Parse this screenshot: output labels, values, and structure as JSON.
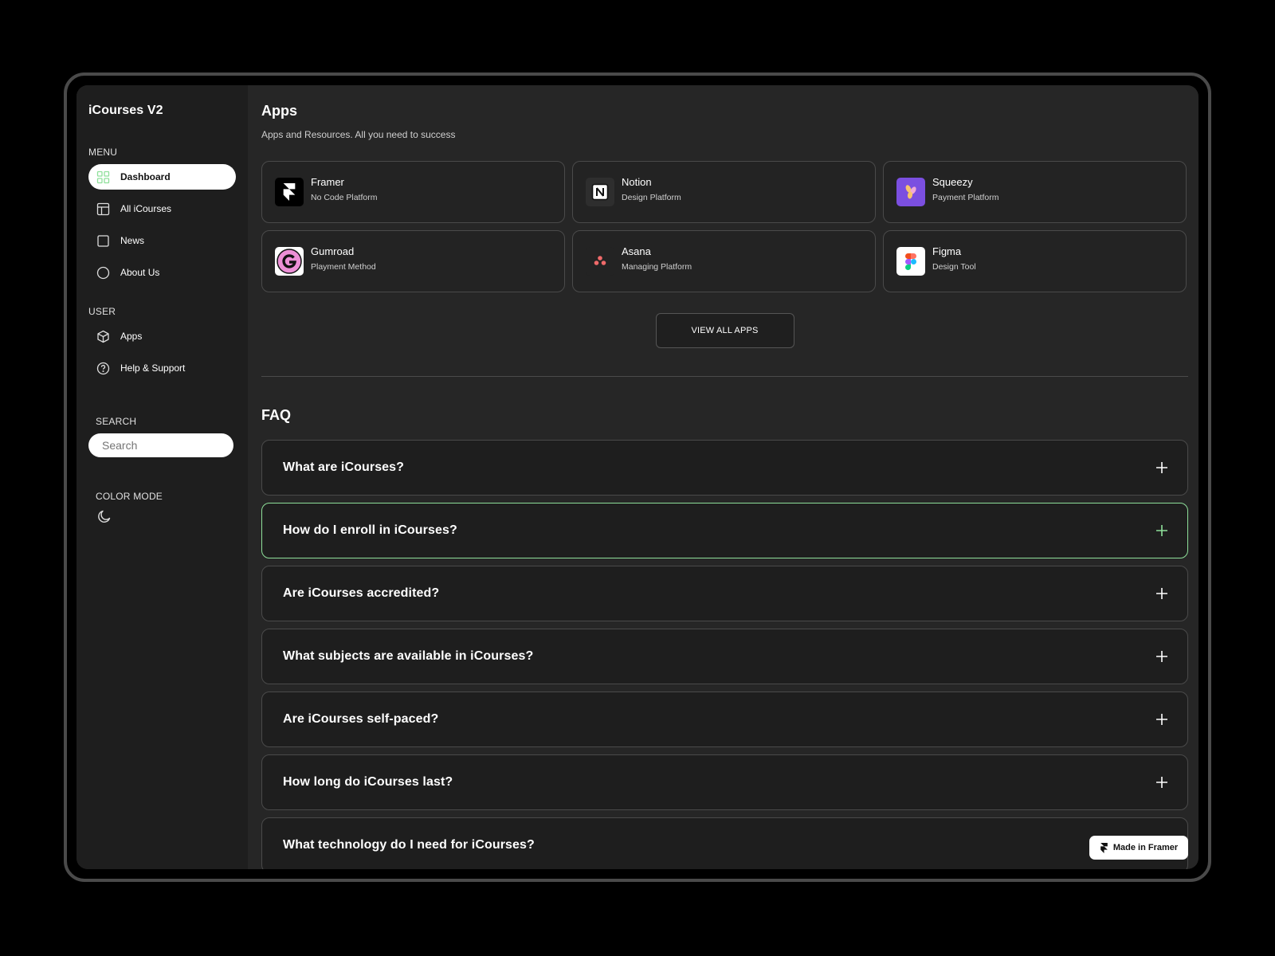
{
  "sidebar": {
    "brand": "iCourses V2",
    "menu_label": "MENU",
    "menu_items": [
      {
        "label": "Dashboard",
        "icon": "grid-icon",
        "active": true
      },
      {
        "label": "All iCourses",
        "icon": "layout-icon"
      },
      {
        "label": "News",
        "icon": "square-icon"
      },
      {
        "label": "About Us",
        "icon": "circle-icon"
      }
    ],
    "user_label": "USER",
    "user_items": [
      {
        "label": "Apps",
        "icon": "cube-icon"
      },
      {
        "label": "Help & Support",
        "icon": "help-circle-icon"
      }
    ],
    "search_label": "SEARCH",
    "search_placeholder": "Search",
    "color_mode_label": "COLOR MODE",
    "color_mode_icon": "moon-icon"
  },
  "apps": {
    "title": "Apps",
    "subtitle": "Apps and Resources. All you need to success",
    "items": [
      {
        "name": "Framer",
        "desc": "No Code Platform",
        "icon": "framer-logo"
      },
      {
        "name": "Notion",
        "desc": "Design Platform",
        "icon": "notion-logo"
      },
      {
        "name": "Squeezy",
        "desc": "Payment Platform",
        "icon": "squeezy-logo"
      },
      {
        "name": "Gumroad",
        "desc": "Playment Method",
        "icon": "gumroad-logo"
      },
      {
        "name": "Asana",
        "desc": "Managing Platform",
        "icon": "asana-logo"
      },
      {
        "name": "Figma",
        "desc": "Design Tool",
        "icon": "figma-logo"
      }
    ],
    "view_all_label": "VIEW ALL APPS"
  },
  "faq": {
    "title": "FAQ",
    "items": [
      "What are iCourses?",
      "How do I enroll in iCourses?",
      "Are iCourses accredited?",
      "What subjects are available in iCourses?",
      "Are iCourses self-paced?",
      "How long do iCourses last?",
      "What technology do I need for iCourses?"
    ]
  },
  "badge": {
    "label": "Made in Framer"
  },
  "colors": {
    "accent_green": "#8ee09a",
    "background": "#262626",
    "sidebar": "#1e1e1e"
  }
}
